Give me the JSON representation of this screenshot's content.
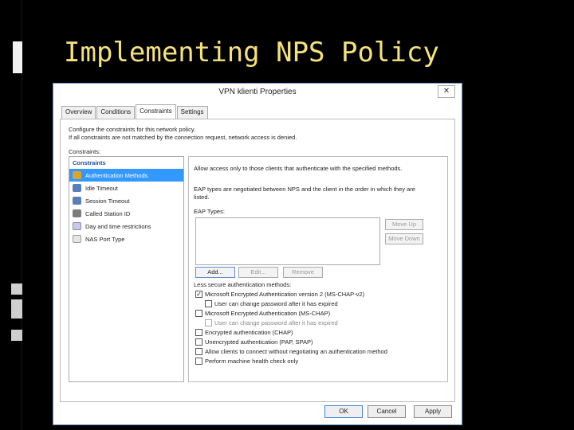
{
  "slide": {
    "title": "Implementing NPS Policy"
  },
  "dialog": {
    "title": "VPN klienti Properties",
    "close_glyph": "✕",
    "tabs": [
      {
        "label": "Overview",
        "active": false
      },
      {
        "label": "Conditions",
        "active": false
      },
      {
        "label": "Constraints",
        "active": true
      },
      {
        "label": "Settings",
        "active": false
      }
    ],
    "intro_line1": "Configure the constraints for this network policy.",
    "intro_line2": "If all constraints are not matched by the connection request, network access is denied.",
    "constraints_label": "Constraints:",
    "constraint_list": {
      "header": "Constraints",
      "items": [
        {
          "label": "Authentication Methods",
          "icon": "lock-icon",
          "selected": true
        },
        {
          "label": "Idle Timeout",
          "icon": "clock-person-icon",
          "selected": false
        },
        {
          "label": "Session Timeout",
          "icon": "clock-person-icon",
          "selected": false
        },
        {
          "label": "Called Station ID",
          "icon": "phone-icon",
          "selected": false
        },
        {
          "label": "Day and time restrictions",
          "icon": "calendar-icon",
          "selected": false
        },
        {
          "label": "NAS Port Type",
          "icon": "network-port-icon",
          "selected": false
        }
      ]
    },
    "right_pane": {
      "allow_text": "Allow access only to those clients that authenticate with the specified methods.",
      "eap_note_line1": "EAP types are negotiated between NPS and the client in the order in which they are",
      "eap_note_line2": "listed.",
      "eap_types_label": "EAP Types:",
      "move_up": "Move Up",
      "move_down": "Move Down",
      "add": "Add...",
      "edit": "Edit...",
      "remove": "Remove",
      "less_secure_label": "Less secure authentication methods:",
      "options": [
        {
          "label": "Microsoft Encrypted Authentication version 2 (MS-CHAP-v2)",
          "checked": true,
          "indent": false,
          "disabled": false
        },
        {
          "label": "User can change password after it has expired",
          "checked": false,
          "indent": true,
          "disabled": false
        },
        {
          "label": "Microsoft Encrypted Authentication (MS-CHAP)",
          "checked": false,
          "indent": false,
          "disabled": false
        },
        {
          "label": "User can change password after it has expired",
          "checked": false,
          "indent": true,
          "disabled": true
        },
        {
          "label": "Encrypted authentication (CHAP)",
          "checked": false,
          "indent": false,
          "disabled": false
        },
        {
          "label": "Unencrypted authentication (PAP, SPAP)",
          "checked": false,
          "indent": false,
          "disabled": false
        },
        {
          "label": "Allow clients to connect without negotiating an authentication method",
          "checked": false,
          "indent": false,
          "disabled": false
        },
        {
          "label": "Perform machine health check only",
          "checked": false,
          "indent": false,
          "disabled": false
        }
      ]
    },
    "footer": {
      "ok": "OK",
      "cancel": "Cancel",
      "apply": "Apply"
    }
  },
  "colors": {
    "title_text": "#f5e27a",
    "selection": "#3399ff",
    "constraint_header": "#1f4e9c"
  }
}
